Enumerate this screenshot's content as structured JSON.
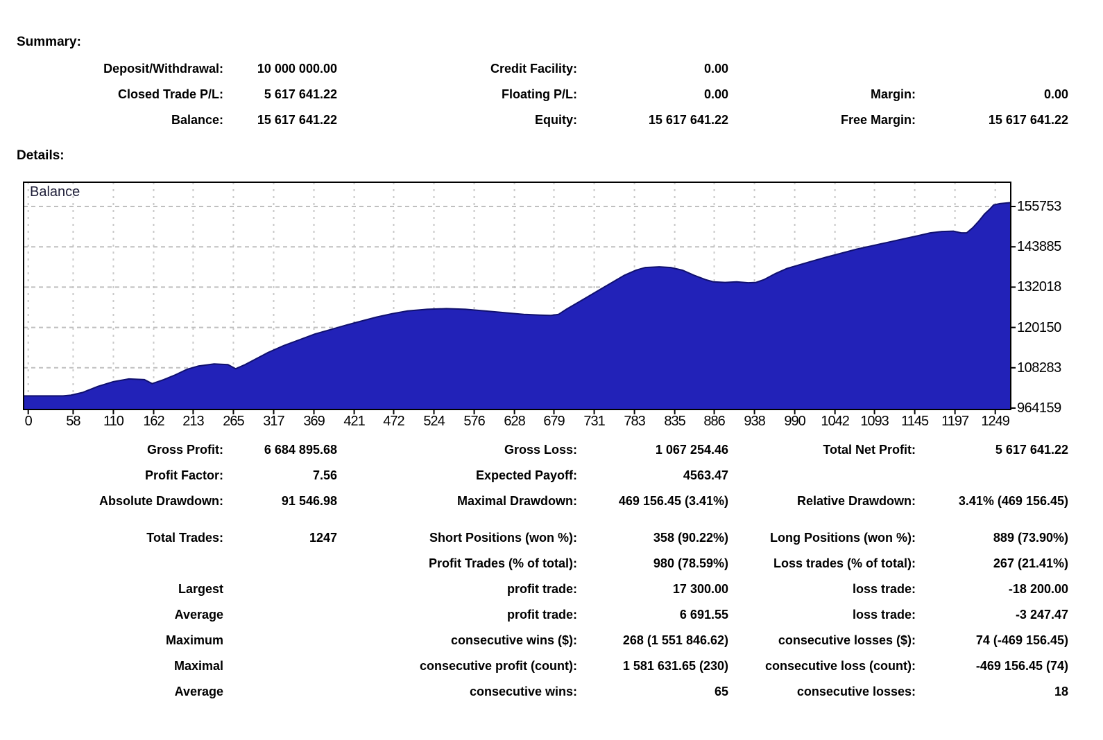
{
  "page": {
    "background": "#ffffff"
  },
  "summary": {
    "heading": "Summary:",
    "rows": [
      [
        "Deposit/Withdrawal:",
        "10 000 000.00",
        "Credit Facility:",
        "0.00",
        "",
        ""
      ],
      [
        "Closed Trade P/L:",
        "5 617 641.22",
        "Floating P/L:",
        "0.00",
        "Margin:",
        "0.00"
      ],
      [
        "Balance:",
        "15 617 641.22",
        "Equity:",
        "15 617 641.22",
        "Free Margin:",
        "15 617 641.22"
      ]
    ]
  },
  "details": {
    "heading": "Details:"
  },
  "chart_data": {
    "type": "area",
    "series_label": "Balance",
    "x_ticks": [
      0,
      58,
      110,
      162,
      213,
      265,
      317,
      369,
      421,
      472,
      524,
      576,
      628,
      679,
      731,
      783,
      835,
      886,
      938,
      990,
      1042,
      1093,
      1145,
      1197,
      1249
    ],
    "y_tick_labels": [
      "155753",
      "143885",
      "132018",
      "120150",
      "108283",
      "964159"
    ],
    "y_tick_values": [
      15575315,
      14388571,
      13201827,
      12015083,
      10828339,
      9641595
    ],
    "x_range": [
      -6,
      1269
    ],
    "y_range": [
      9600000,
      16290000
    ],
    "grid": true,
    "legend_position": "top-left",
    "colors": {
      "fill": "#2222B8",
      "line": "#10106E",
      "grid_v": "#c8c8c8",
      "grid_h": "#bfbfbf",
      "border": "#000000"
    },
    "balance_curve": [
      [
        -6,
        10000000
      ],
      [
        0,
        10000000
      ],
      [
        45,
        10000000
      ],
      [
        55,
        10020000
      ],
      [
        70,
        10100000
      ],
      [
        90,
        10280000
      ],
      [
        110,
        10420000
      ],
      [
        130,
        10500000
      ],
      [
        150,
        10480000
      ],
      [
        160,
        10360000
      ],
      [
        175,
        10480000
      ],
      [
        190,
        10620000
      ],
      [
        205,
        10780000
      ],
      [
        220,
        10880000
      ],
      [
        240,
        10940000
      ],
      [
        258,
        10920000
      ],
      [
        268,
        10800000
      ],
      [
        280,
        10920000
      ],
      [
        295,
        11100000
      ],
      [
        310,
        11280000
      ],
      [
        330,
        11480000
      ],
      [
        350,
        11650000
      ],
      [
        370,
        11820000
      ],
      [
        390,
        11950000
      ],
      [
        410,
        12080000
      ],
      [
        430,
        12200000
      ],
      [
        450,
        12320000
      ],
      [
        470,
        12420000
      ],
      [
        490,
        12500000
      ],
      [
        515,
        12550000
      ],
      [
        540,
        12570000
      ],
      [
        565,
        12550000
      ],
      [
        590,
        12500000
      ],
      [
        615,
        12450000
      ],
      [
        640,
        12400000
      ],
      [
        660,
        12380000
      ],
      [
        675,
        12370000
      ],
      [
        685,
        12400000
      ],
      [
        695,
        12550000
      ],
      [
        710,
        12750000
      ],
      [
        725,
        12950000
      ],
      [
        740,
        13150000
      ],
      [
        755,
        13350000
      ],
      [
        770,
        13550000
      ],
      [
        785,
        13700000
      ],
      [
        797,
        13780000
      ],
      [
        815,
        13800000
      ],
      [
        830,
        13780000
      ],
      [
        845,
        13700000
      ],
      [
        860,
        13550000
      ],
      [
        875,
        13420000
      ],
      [
        885,
        13360000
      ],
      [
        900,
        13340000
      ],
      [
        915,
        13360000
      ],
      [
        930,
        13330000
      ],
      [
        940,
        13340000
      ],
      [
        950,
        13420000
      ],
      [
        965,
        13600000
      ],
      [
        980,
        13750000
      ],
      [
        995,
        13850000
      ],
      [
        1010,
        13950000
      ],
      [
        1030,
        14080000
      ],
      [
        1050,
        14200000
      ],
      [
        1070,
        14320000
      ],
      [
        1090,
        14420000
      ],
      [
        1110,
        14520000
      ],
      [
        1130,
        14620000
      ],
      [
        1150,
        14720000
      ],
      [
        1165,
        14800000
      ],
      [
        1180,
        14840000
      ],
      [
        1195,
        14850000
      ],
      [
        1205,
        14800000
      ],
      [
        1212,
        14800000
      ],
      [
        1220,
        14950000
      ],
      [
        1228,
        15150000
      ],
      [
        1235,
        15350000
      ],
      [
        1242,
        15500000
      ],
      [
        1247,
        15620000
      ],
      [
        1255,
        15660000
      ],
      [
        1269,
        15690000
      ]
    ]
  },
  "stats_top": [
    [
      "Gross Profit:",
      "6 684 895.68",
      "Gross Loss:",
      "1 067 254.46",
      "Total Net Profit:",
      "5 617 641.22"
    ],
    [
      "Profit Factor:",
      "7.56",
      "Expected Payoff:",
      "4563.47",
      "",
      ""
    ],
    [
      "Absolute Drawdown:",
      "91 546.98",
      "Maximal Drawdown:",
      "469 156.45 (3.41%)",
      "Relative Drawdown:",
      "3.41% (469 156.45)"
    ]
  ],
  "stats_bottom": [
    [
      "Total Trades:",
      "1247",
      "Short Positions (won %):",
      "358 (90.22%)",
      "Long Positions (won %):",
      "889 (73.90%)"
    ],
    [
      "",
      "",
      "Profit Trades (% of total):",
      "980 (78.59%)",
      "Loss trades (% of total):",
      "267 (21.41%)"
    ],
    [
      "Largest",
      "",
      "profit trade:",
      "17 300.00",
      "loss trade:",
      "-18 200.00"
    ],
    [
      "Average",
      "",
      "profit trade:",
      "6 691.55",
      "loss trade:",
      "-3 247.47"
    ],
    [
      "Maximum",
      "",
      "consecutive wins ($):",
      "268 (1 551 846.62)",
      "consecutive losses ($):",
      "74 (-469 156.45)"
    ],
    [
      "Maximal",
      "",
      "consecutive profit (count):",
      "1 581 631.65 (230)",
      "consecutive loss (count):",
      "-469 156.45 (74)"
    ],
    [
      "Average",
      "",
      "consecutive wins:",
      "65",
      "consecutive losses:",
      "18"
    ]
  ]
}
